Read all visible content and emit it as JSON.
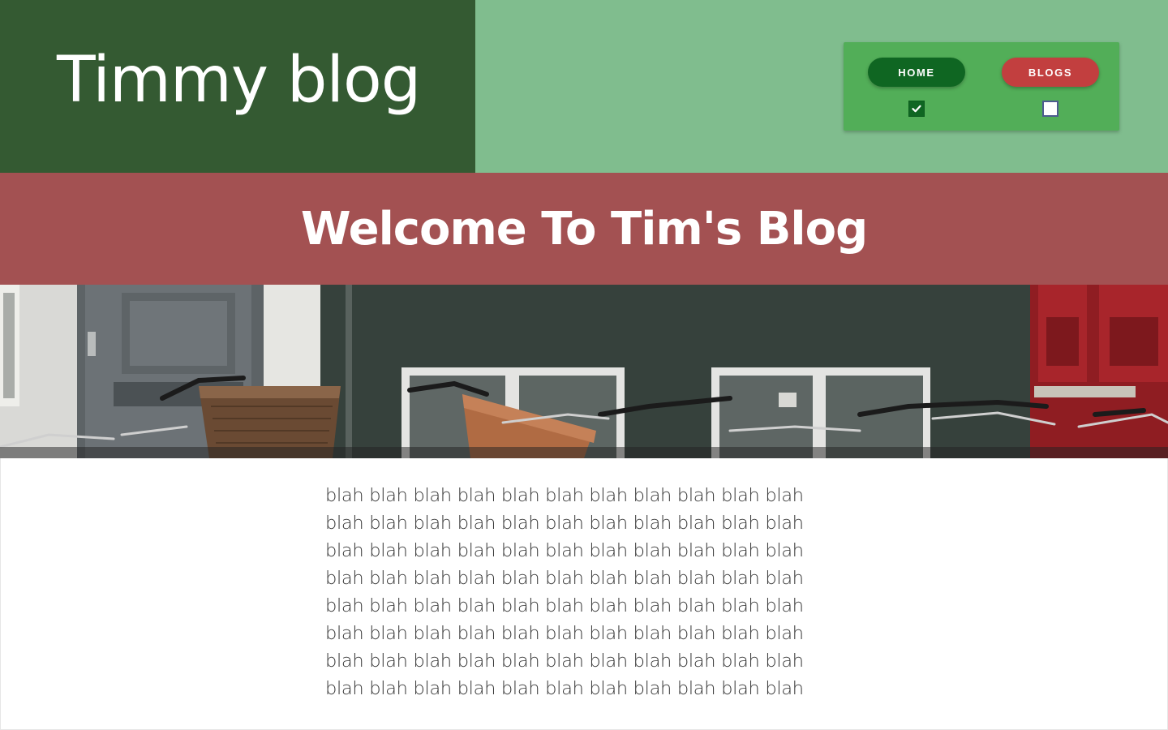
{
  "header": {
    "site_title": "Timmy blog",
    "nav": {
      "home_label": "HOME",
      "blogs_label": "BLOGS",
      "home_checked": true,
      "blogs_checked": false
    }
  },
  "welcome": {
    "title": "Welcome To Tim's Blog"
  },
  "content": {
    "lines": [
      "blah blah blah blah blah blah blah blah blah blah blah",
      "blah blah blah blah blah blah blah blah blah blah blah",
      "blah blah blah blah blah blah blah blah blah blah blah",
      "blah blah blah blah blah blah blah blah blah blah blah",
      "blah blah blah blah blah blah blah blah blah blah blah",
      "blah blah blah blah blah blah blah blah blah blah blah",
      "blah blah blah blah blah blah blah blah blah blah blah",
      "blah blah blah blah blah blah blah blah blah blah blah"
    ]
  },
  "colors": {
    "brand_dark_green": "#345a32",
    "header_light_green": "#80bd8e",
    "nav_card_green": "#52ae58",
    "home_pill": "#0f6622",
    "blogs_pill": "#c23f3f",
    "welcome_band": "#a35152"
  },
  "icons": {
    "home_checkbox": "checkmark-icon",
    "hero_image": "bicycles-street-photo"
  }
}
